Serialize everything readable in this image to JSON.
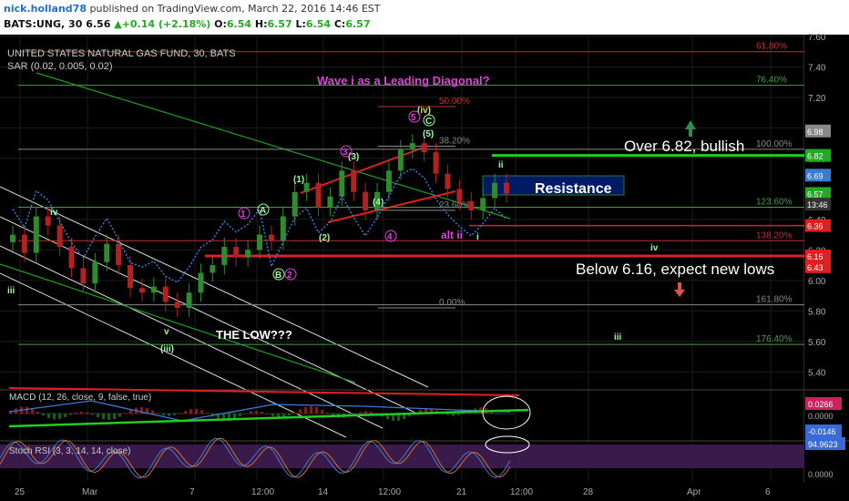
{
  "header": {
    "user": "nick.holland78",
    "published": "published on TradingView.com, March 22, 2016 14:46 EST",
    "symbol": "BATS:UNG, 30",
    "price": "6.56",
    "change": "+0.14 (+2.18%)",
    "ohlc_o_label": "O:",
    "ohlc_o": "6.54",
    "ohlc_h_label": "H:",
    "ohlc_h": "6.57",
    "ohlc_l_label": "L:",
    "ohlc_l": "6.54",
    "ohlc_c_label": "C:",
    "ohlc_c": "6.57"
  },
  "colors": {
    "bg": "#000000",
    "grid": "#1c1c1c",
    "bull": "#2e8b2e",
    "bear": "#b22222",
    "green_line": "#22cc22",
    "red_line": "#e02020",
    "sar": "#3a7bd5",
    "magenta": "#e040e0",
    "stoch_bg": "#3a1a4a"
  },
  "chart_data": {
    "type": "candlestick",
    "title": "UNITED STATES NATURAL GAS FUND, 30, BATS",
    "indicator_label": "SAR (0.02, 0.005, 0.02)",
    "ylim": [
      5.3,
      7.6
    ],
    "y_ticks": [
      7.6,
      7.4,
      7.2,
      7.0,
      6.8,
      6.4,
      6.2,
      6.0,
      5.8,
      5.6,
      5.4
    ],
    "x_ticks": [
      "25",
      "Mar",
      "7",
      "12:00",
      "14",
      "12:00",
      "21",
      "12:00",
      "28",
      "Apr",
      "6"
    ],
    "series_close": [
      6.3,
      6.18,
      6.42,
      6.36,
      6.22,
      6.08,
      5.98,
      6.12,
      6.24,
      6.1,
      5.95,
      5.92,
      5.96,
      5.86,
      5.82,
      5.92,
      6.05,
      6.1,
      6.22,
      6.15,
      6.2,
      6.3,
      6.26,
      6.42,
      6.58,
      6.64,
      6.48,
      6.55,
      6.72,
      6.58,
      6.46,
      6.58,
      6.72,
      6.86,
      6.9,
      6.84,
      6.7,
      6.6,
      6.52,
      6.46,
      6.54,
      6.64,
      6.57
    ],
    "fib_levels": [
      {
        "label": "61.80%",
        "price": 7.5
      },
      {
        "label": "76.40%",
        "price": 7.28
      },
      {
        "label": "50.00%",
        "price": 7.14
      },
      {
        "label": "100.00%",
        "price": 6.86
      },
      {
        "label": "38.20%",
        "price": 6.88
      },
      {
        "label": "123.60%",
        "price": 6.48
      },
      {
        "label": "23.60%",
        "price": 6.46
      },
      {
        "label": "138.20%",
        "price": 6.26
      },
      {
        "label": "161.80%",
        "price": 5.84
      },
      {
        "label": "0.00%",
        "price": 5.82
      },
      {
        "label": "176.40%",
        "price": 5.58
      }
    ],
    "price_tags": [
      {
        "label": "6.98",
        "price": 6.98,
        "color": "#888888"
      },
      {
        "label": "6.82",
        "price": 6.82,
        "color": "#22aa22"
      },
      {
        "label": "6.69",
        "price": 6.69,
        "color": "#3a7bd5"
      },
      {
        "label": "6.57",
        "price": 6.57,
        "color": "#22aa22"
      },
      {
        "label": "13:46",
        "price": 6.5,
        "color": "#333333"
      },
      {
        "label": "6.36",
        "price": 6.36,
        "color": "#e02020"
      },
      {
        "label": "6.16",
        "price": 6.16,
        "color": "#e02020"
      },
      {
        "label": "6.43",
        "price": 6.09,
        "color": "#e02020"
      }
    ],
    "annotations": {
      "headline": "Wave i as a Leading Diagonal?",
      "bullish": "Over 6.82, bullish",
      "bearish": "Below 6.16, expect new lows",
      "resistance": "Resistance",
      "the_low": "THE LOW???",
      "alt_ii": "alt ii"
    },
    "wave_labels": [
      "iv",
      "iii",
      "v",
      "(iii)",
      "(iv)",
      "(1)",
      "(2)",
      "(3)",
      "(4)",
      "(5)",
      "1",
      "2",
      "3",
      "4",
      "5",
      "A",
      "B",
      "C",
      "i",
      "ii",
      "iv",
      "iii"
    ],
    "macd": {
      "label": "MACD (12, 26, close, 9, false, true)",
      "value1": "0.0266",
      "value2": "-0.0146",
      "ticks": [
        "0.0000"
      ]
    },
    "stoch": {
      "label": "Stoch RSI (3, 3, 14, 14, close)",
      "value": "94.9623",
      "ticks": [
        "0.0000"
      ]
    }
  }
}
